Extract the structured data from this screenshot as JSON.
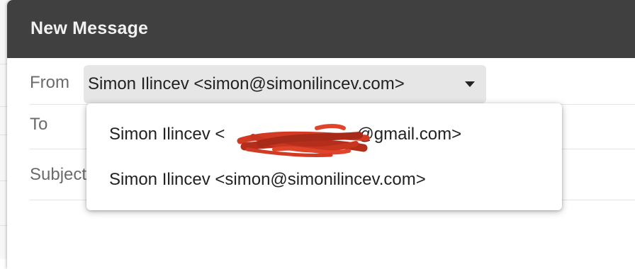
{
  "compose": {
    "title": "New Message",
    "from_label": "From",
    "from_value": "Simon Ilincev <simon@simonilincev.com>",
    "to_label": "To",
    "subject_label": "Subject"
  },
  "from_menu": {
    "options": [
      {
        "label_prefix": "Simon Ilincev ",
        "label_redacted": "<",
        "label_suffix": "@gmail.com>"
      },
      {
        "label": "Simon Ilincev <simon@simonilincev.com>"
      }
    ]
  },
  "colors": {
    "titlebar": "#404040",
    "redaction": "#c0321f"
  }
}
